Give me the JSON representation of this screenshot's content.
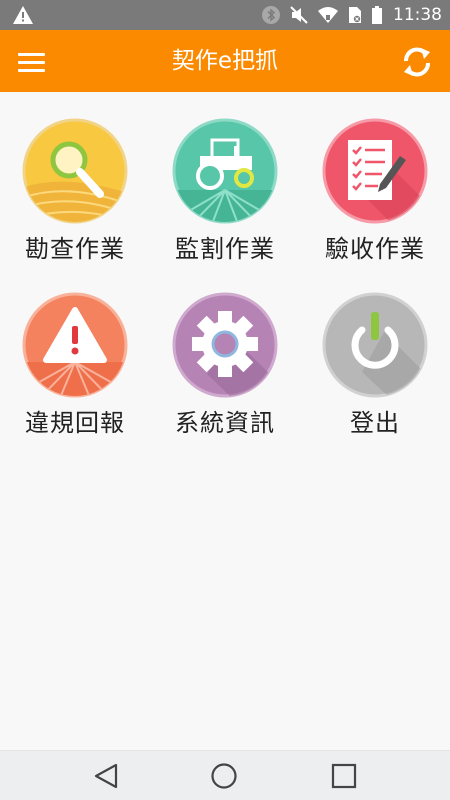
{
  "status_bar": {
    "time": "11:38",
    "icons": [
      "warning-icon",
      "bluetooth-icon",
      "mute-icon",
      "wifi-icon",
      "sim-icon",
      "battery-icon"
    ]
  },
  "app_bar": {
    "title": "契作e把抓",
    "left_icon": "menu-icon",
    "right_icon": "refresh-icon",
    "color": "#fb8a00"
  },
  "menu": {
    "items": [
      {
        "label": "勘查作業",
        "icon": "magnifier-field-icon",
        "color": "#f7c840"
      },
      {
        "label": "監割作業",
        "icon": "tractor-icon",
        "color": "#58c6a8"
      },
      {
        "label": "驗收作業",
        "icon": "checklist-pen-icon",
        "color": "#f0566a"
      },
      {
        "label": "違規回報",
        "icon": "warning-triangle-icon",
        "color": "#f5825e"
      },
      {
        "label": "系統資訊",
        "icon": "gear-icon",
        "color": "#b583b4"
      },
      {
        "label": "登出",
        "icon": "power-icon",
        "color": "#b7b7b7"
      }
    ]
  },
  "nav_bar": {
    "buttons": [
      "back-icon",
      "home-icon",
      "recents-icon"
    ]
  }
}
